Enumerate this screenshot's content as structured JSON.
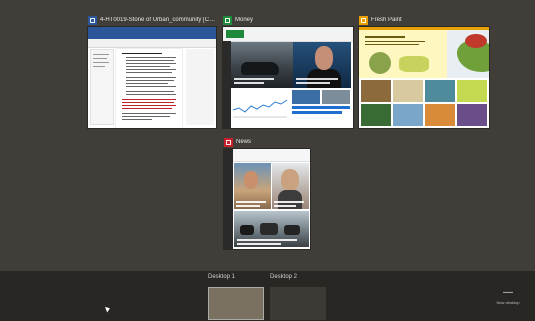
{
  "windows": [
    {
      "app": "word",
      "title": "4-HT0019-Stone of Urban_community [Compatib...",
      "icon": "word-icon"
    },
    {
      "app": "money",
      "title": "Money",
      "icon": "money-icon"
    },
    {
      "app": "paint",
      "title": "Fresh Paint",
      "icon": "fresh-paint-icon"
    },
    {
      "app": "news",
      "title": "News",
      "icon": "news-icon"
    }
  ],
  "desktops": [
    {
      "label": "Desktop 1",
      "active": true
    },
    {
      "label": "Desktop 2",
      "active": false
    }
  ],
  "new_desktop": {
    "icon": "plus-icon",
    "label": "New desktop"
  },
  "colors": {
    "background": "#413e3a",
    "taskbar": "#292724",
    "word": "#2b579a",
    "money": "#1f8a3b",
    "paint": "#e8a100",
    "news": "#c8202a"
  }
}
